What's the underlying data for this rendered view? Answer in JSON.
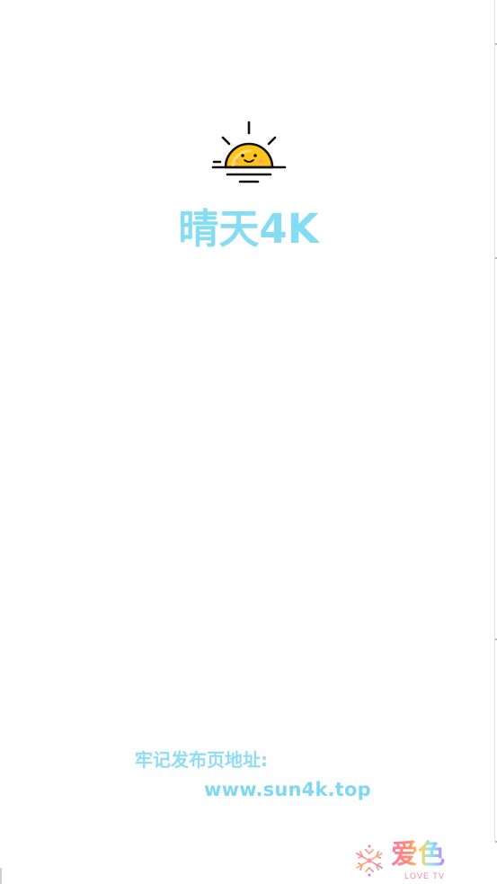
{
  "app": {
    "title": "晴天4K",
    "logo_icon": "sun-icon",
    "title_color": "#86dcf3"
  },
  "notice": {
    "label": "牢记发布页地址:",
    "url": "www.sun4k.top",
    "text_color": "#8fdcf4"
  },
  "brand": {
    "icon": "snowflake-icon",
    "name": "爱色",
    "subtitle": "LOVE TV"
  }
}
